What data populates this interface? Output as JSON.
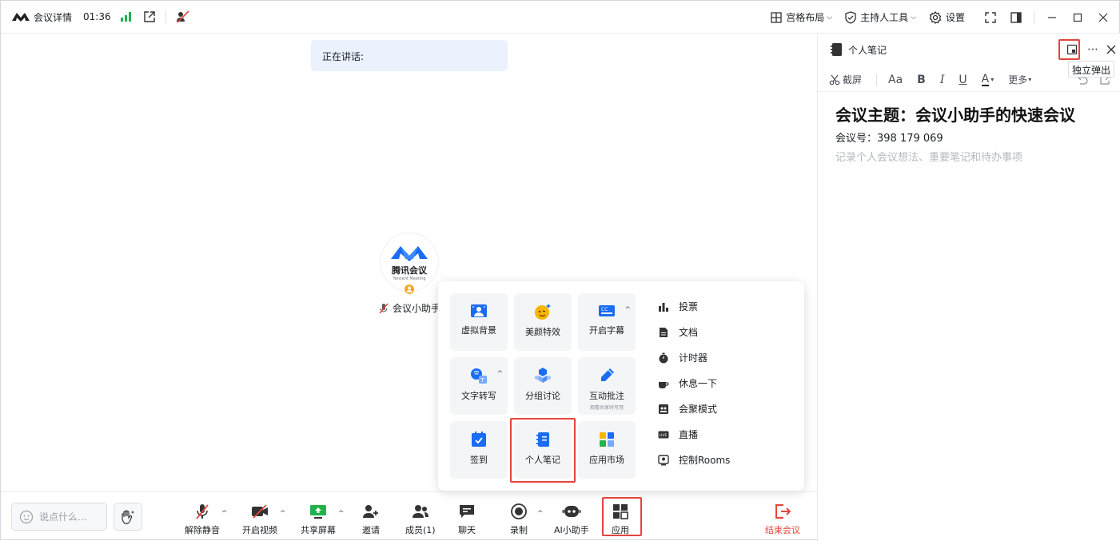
{
  "topbar": {
    "title": "会议详情",
    "time": "01:36",
    "layout_label": "宫格布局",
    "host_tools_label": "主持人工具",
    "settings_label": "设置"
  },
  "stage": {
    "speaking_label": "正在讲话:",
    "avatar_brand": "腾讯会议",
    "avatar_brand_en": "Tencent Meeting",
    "participant_name": "会议小助手"
  },
  "apps_popup": {
    "tiles": [
      {
        "label": "虚拟背景"
      },
      {
        "label": "美颜特效"
      },
      {
        "label": "开启字幕"
      },
      {
        "label": "文字转写"
      },
      {
        "label": "分组讨论"
      },
      {
        "label": "互动批注",
        "sub": "观看共享时可用"
      },
      {
        "label": "签到"
      },
      {
        "label": "个人笔记"
      },
      {
        "label": "应用市场"
      }
    ],
    "list": [
      "投票",
      "文档",
      "计时器",
      "休息一下",
      "会聚模式",
      "直播",
      "控制Rooms"
    ]
  },
  "bottombar": {
    "chat_placeholder": "说点什么...",
    "items": [
      "解除静音",
      "开启视频",
      "共享屏幕",
      "邀请",
      "成员(1)",
      "聊天",
      "录制",
      "AI小助手",
      "应用"
    ],
    "end_label": "结束会议"
  },
  "notes_panel": {
    "title": "个人笔记",
    "tooltip": "独立弹出",
    "tools": {
      "screenshot": "截屏",
      "more": "更多"
    },
    "doc_title": "会议主题：会议小助手的快速会议",
    "doc_meeting_id": "会议号：398 179 069",
    "doc_placeholder": "记录个人会议想法、重要笔记和待办事项"
  },
  "colors": {
    "accent": "#1a6cf5",
    "danger": "#e5453c",
    "highlight_border": "#e5453c"
  }
}
